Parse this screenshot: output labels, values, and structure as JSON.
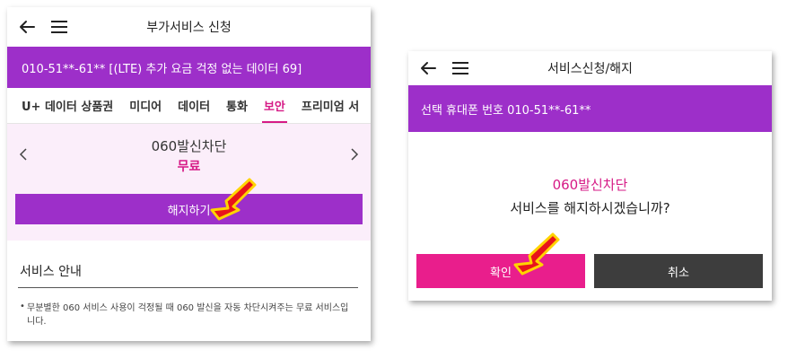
{
  "left_screen": {
    "header": {
      "title": "부가서비스 신청",
      "back_icon": "arrow-left-icon",
      "menu_icon": "hamburger-menu-icon"
    },
    "plan_bar": {
      "text": "010-51**-61** [(LTE) 추가 요금 걱정 없는 데이터 69]"
    },
    "tabs": [
      {
        "label": "U+ 데이터 상품권",
        "active": false
      },
      {
        "label": "미디어",
        "active": false
      },
      {
        "label": "데이터",
        "active": false
      },
      {
        "label": "통화",
        "active": false
      },
      {
        "label": "보안",
        "active": true
      },
      {
        "label": "프리미엄 서",
        "active": false
      }
    ],
    "service": {
      "name": "060발신차단",
      "price": "무료",
      "cancel_label": "해지하기"
    },
    "info": {
      "title": "서비스 안내",
      "bullet": "•",
      "text": "무분별한 060 서비스 사용이 걱정될 때 060 발신을 자동 차단시켜주는 무료 서비스입니다."
    }
  },
  "right_screen": {
    "header": {
      "title": "서비스신청/해지",
      "back_icon": "arrow-left-icon",
      "menu_icon": "hamburger-menu-icon"
    },
    "phone_bar": {
      "text": "선택 휴대폰 번호 010-51**-61**"
    },
    "dialog": {
      "service_name": "060발신차단",
      "question": "서비스를 해지하시겠습니까?",
      "confirm_label": "확인",
      "cancel_label": "취소"
    }
  },
  "colors": {
    "purple": "#9d2fc9",
    "magenta": "#d61a86",
    "confirm": "#e91e8c",
    "dark": "#3d3d3d",
    "arrow_red": "#e8151b",
    "arrow_yellow": "#ffd400"
  }
}
